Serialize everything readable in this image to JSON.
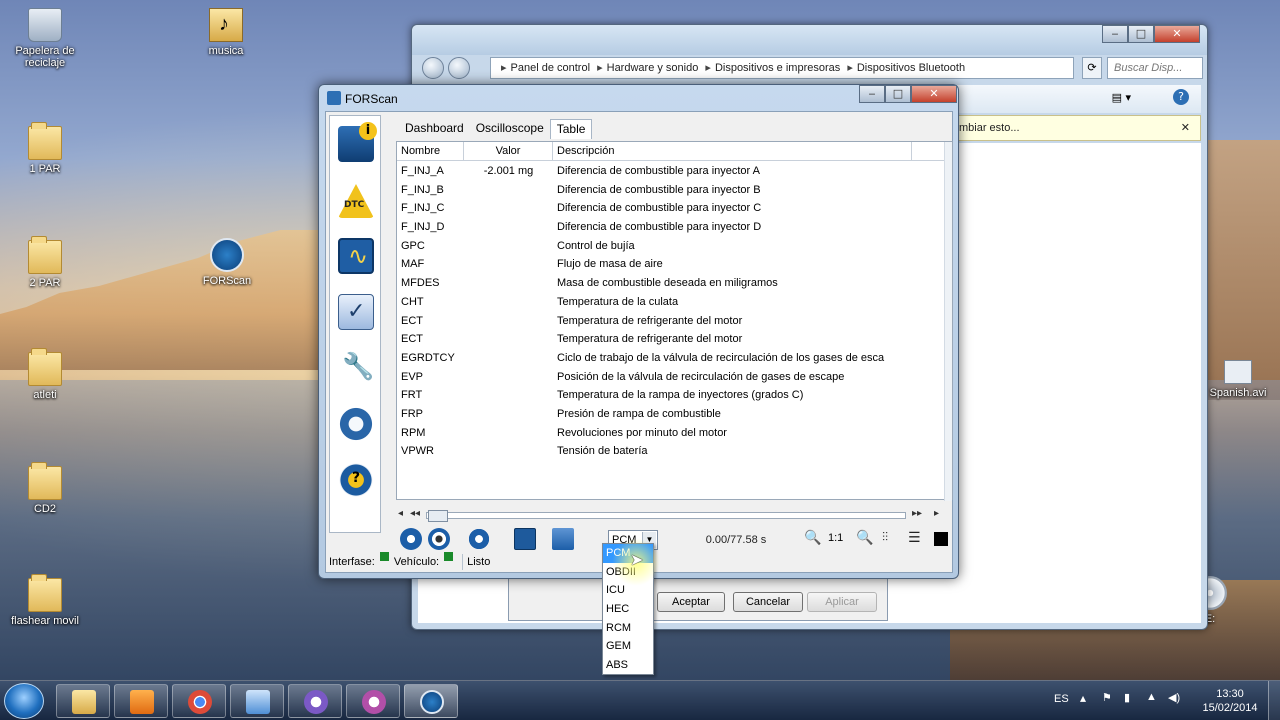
{
  "desktop": {
    "icons": [
      {
        "label": "Papelera de\nreciclaje",
        "icon": "recycle-bin-icon"
      },
      {
        "label": "musica",
        "icon": "music-folder-icon"
      },
      {
        "label": "1 PAR",
        "icon": "folder-icon"
      },
      {
        "label": "2 PAR",
        "icon": "folder-icon"
      },
      {
        "label": "FORScan",
        "icon": "forscan-shortcut-icon"
      },
      {
        "label": "atleti",
        "icon": "folder-icon"
      },
      {
        "label": "CD2",
        "icon": "folder-icon"
      },
      {
        "label": "flashear movil",
        "icon": "folder-icon"
      },
      {
        "label": "Spanish.avi",
        "icon": "video-file-icon"
      },
      {
        "label": "E:",
        "icon": "cd-drive-icon"
      }
    ]
  },
  "explorer": {
    "breadcrumb": [
      "Panel de control",
      "Hardware y sonido",
      "Dispositivos e impresoras",
      "Dispositivos Bluetooth"
    ],
    "search_placeholder": "Buscar Disp...",
    "infobar_text": "mbiar esto...",
    "dialog_buttons": {
      "ok": "Aceptar",
      "cancel": "Cancelar",
      "apply": "Aplicar"
    }
  },
  "forscan": {
    "title": "FORScan",
    "tabs": [
      "Dashboard",
      "Oscilloscope",
      "Table"
    ],
    "active_tab": "Table",
    "columns": [
      "Nombre",
      "Valor",
      "Descripción"
    ],
    "rows": [
      {
        "name": "F_INJ_A",
        "value": "-2.001 mg",
        "desc": "Diferencia de combustible para inyector A"
      },
      {
        "name": "F_INJ_B",
        "value": "",
        "desc": "Diferencia de combustible para inyector B"
      },
      {
        "name": "F_INJ_C",
        "value": "",
        "desc": "Diferencia de combustible para inyector C"
      },
      {
        "name": "F_INJ_D",
        "value": "",
        "desc": "Diferencia de combustible para inyector D"
      },
      {
        "name": "GPC",
        "value": "",
        "desc": "Control de bujía"
      },
      {
        "name": "MAF",
        "value": "",
        "desc": "Flujo de masa de aire"
      },
      {
        "name": "MFDES",
        "value": "",
        "desc": "Masa de combustible deseada en miligramos"
      },
      {
        "name": "CHT",
        "value": "",
        "desc": "Temperatura de la culata"
      },
      {
        "name": "ECT",
        "value": "",
        "desc": "Temperatura de refrigerante del motor"
      },
      {
        "name": "ECT",
        "value": "",
        "desc": "Temperatura de refrigerante del motor"
      },
      {
        "name": "EGRDTCY",
        "value": "",
        "desc": "Ciclo de trabajo de la válvula de recirculación de los gases de esca"
      },
      {
        "name": "EVP",
        "value": "",
        "desc": "Posición de la válvula de recirculación de gases de escape"
      },
      {
        "name": "FRT",
        "value": "",
        "desc": "Temperatura de la rampa de inyectores (grados C)"
      },
      {
        "name": "FRP",
        "value": "",
        "desc": "Presión de rampa de combustible"
      },
      {
        "name": "RPM",
        "value": "",
        "desc": "Revoluciones por minuto del motor"
      },
      {
        "name": "VPWR",
        "value": "",
        "desc": "Tensión de batería"
      }
    ],
    "module_selected": "PCM",
    "module_options": [
      "PCM",
      "OBDII",
      "ICU",
      "HEC",
      "RCM",
      "GEM",
      "ABS"
    ],
    "time_readout": "0.00/77.58 s",
    "zoom_ratio": "1:1",
    "dtc_label": "DTC",
    "status": {
      "interface_label": "Interfase:",
      "vehicle_label": "Vehículo:",
      "state": "Listo",
      "led_color": "#1a8a2a"
    }
  },
  "taskbar": {
    "lang": "ES",
    "time": "13:30",
    "date": "15/02/2014",
    "apps": [
      "explorer-icon",
      "media-player-icon",
      "chrome-icon",
      "control-panel-icon",
      "gauge-app-icon",
      "gauge-app-2-icon",
      "forscan-icon"
    ]
  }
}
